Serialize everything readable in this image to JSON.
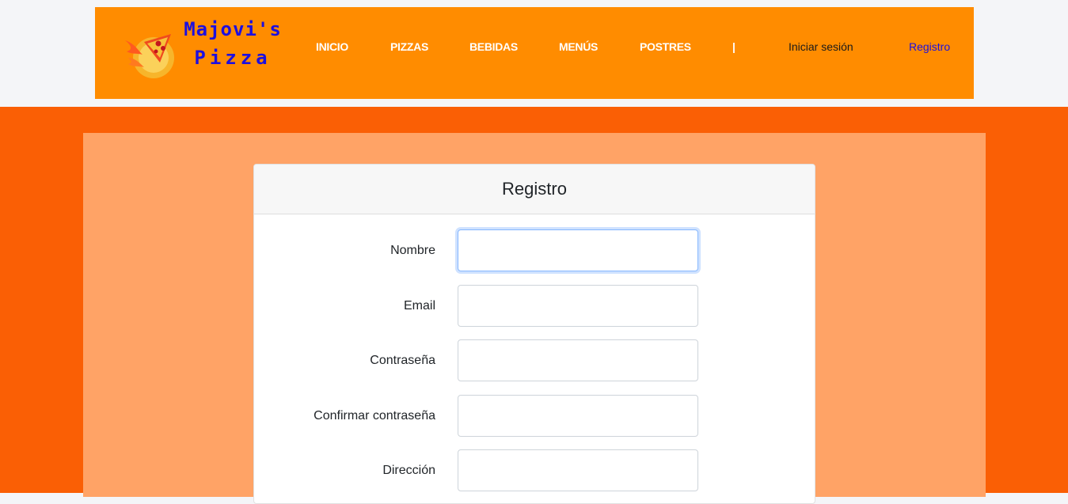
{
  "brand": {
    "name_line1": "Majovi's",
    "name_line2": "Pizza",
    "logo_icon": "pizza-icon"
  },
  "nav": {
    "links": [
      "INICIO",
      "PIZZAS",
      "BEBIDAS",
      "MENÚS",
      "POSTRES"
    ],
    "separator": "|",
    "login": "Iniciar sesión",
    "register": "Registro"
  },
  "colors": {
    "navbar": "#ff8c00",
    "page_background": "#fa5f05",
    "panel": "#ffa366",
    "brand_text": "#1d0fe0",
    "active_link": "#1d0fe0"
  },
  "form": {
    "title": "Registro",
    "fields": [
      {
        "label": "Nombre",
        "value": ""
      },
      {
        "label": "Email",
        "value": ""
      },
      {
        "label": "Contraseña",
        "value": ""
      },
      {
        "label": "Confirmar contraseña",
        "value": ""
      },
      {
        "label": "Dirección",
        "value": ""
      }
    ]
  }
}
